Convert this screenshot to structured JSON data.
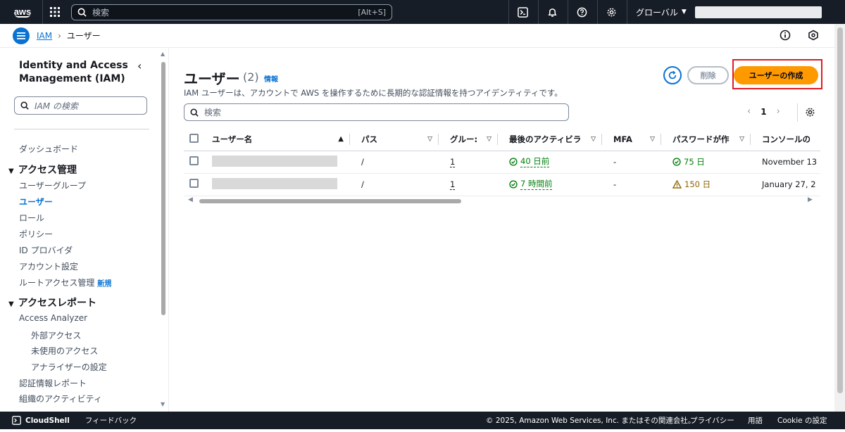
{
  "topnav": {
    "logo": "aws",
    "search_placeholder": "検索",
    "search_shortcut": "[Alt+S]",
    "region": "グローバル"
  },
  "breadcrumb": {
    "service": "IAM",
    "current": "ユーザー"
  },
  "sidebar": {
    "title": "Identity and Access Management (IAM)",
    "search_placeholder": "IAM の検索",
    "dashboard": "ダッシュボード",
    "section_access_management": "アクセス管理",
    "items_access_management": [
      "ユーザーグループ",
      "ユーザー",
      "ロール",
      "ポリシー",
      "ID プロバイダ",
      "アカウント設定",
      "ルートアクセス管理"
    ],
    "new_badge": "新規",
    "section_access_reports": "アクセスレポート",
    "access_analyzer": "Access Analyzer",
    "analyzer_subitems": [
      "外部アクセス",
      "未使用のアクセス",
      "アナライザーの設定"
    ],
    "credential_report": "認証情報レポート",
    "org_activity": "組織のアクティビティ"
  },
  "main": {
    "title": "ユーザー",
    "count": "(2)",
    "info": "情報",
    "description": "IAM ユーザーは、アカウントで AWS を操作するために長期的な認証情報を持つアイデンティティです。",
    "delete_label": "削除",
    "create_label": "ユーザーの作成",
    "search_placeholder": "検索",
    "page_number": "1",
    "columns": [
      "ユーザー名",
      "パス",
      "グルー:",
      "最後のアクティビラ",
      "MFA",
      "パスワードが作",
      "コンソールの"
    ],
    "rows": [
      {
        "path": "/",
        "groups": "1",
        "last_activity": "40 日前",
        "mfa": "-",
        "password_age": "75 日",
        "password_status": "ok",
        "console": "November 13"
      },
      {
        "path": "/",
        "groups": "1",
        "last_activity": "7 時間前",
        "mfa": "-",
        "password_age": "150 日",
        "password_status": "warn",
        "console": "January 27, 2"
      }
    ]
  },
  "footer": {
    "cloudshell": "CloudShell",
    "feedback": "フィードバック",
    "copyright": "© 2025, Amazon Web Services, Inc. またはその関連会社。",
    "privacy": "プライバシー",
    "terms": "用語",
    "cookie": "Cookie の設定"
  },
  "colors": {
    "nav_bg": "#161d26",
    "primary": "#0972d3",
    "create_button": "#ff9900",
    "success": "#037f0c",
    "warning": "#8d6605",
    "highlight": "#e01b24"
  }
}
